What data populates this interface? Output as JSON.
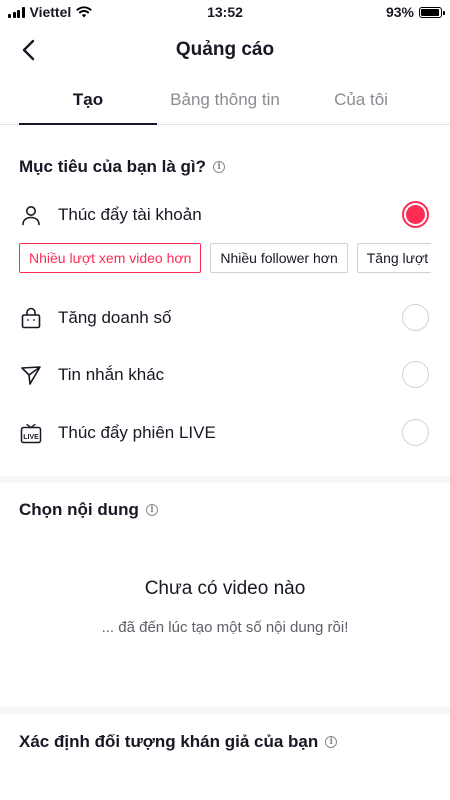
{
  "status_bar": {
    "carrier": "Viettel",
    "time": "13:52",
    "battery_percent": "93%",
    "battery_level": 0.93
  },
  "header": {
    "title": "Quảng cáo",
    "back_icon": "chevron-left-icon"
  },
  "tabs": [
    {
      "label": "Tạo",
      "active": true
    },
    {
      "label": "Bảng thông tin",
      "active": false
    },
    {
      "label": "Của tôi",
      "active": false
    }
  ],
  "goal_section": {
    "title": "Mục tiêu của bạn là gì?",
    "options": [
      {
        "label": "Thúc đẩy tài khoản",
        "icon": "person-icon",
        "selected": true
      },
      {
        "label": "Tăng doanh số",
        "icon": "shopping-bag-icon",
        "selected": false
      },
      {
        "label": "Tin nhắn khác",
        "icon": "send-icon",
        "selected": false
      },
      {
        "label": "Thúc đẩy phiên LIVE",
        "icon": "live-tv-icon",
        "selected": false
      }
    ],
    "chips": [
      {
        "label": "Nhiều lượt xem video hơn",
        "selected": true
      },
      {
        "label": "Nhiều follower hơn",
        "selected": false
      },
      {
        "label": "Tăng lượt",
        "selected": false
      }
    ]
  },
  "content_section": {
    "title": "Chọn nội dung",
    "empty_title": "Chưa có video nào",
    "empty_subtitle": "... đã đến lúc tạo một số nội dung rồi!"
  },
  "audience_section": {
    "title": "Xác định đối tượng khán giả của bạn"
  },
  "colors": {
    "accent": "#fe2c55",
    "text": "#161823",
    "muted": "#8a8b91"
  }
}
